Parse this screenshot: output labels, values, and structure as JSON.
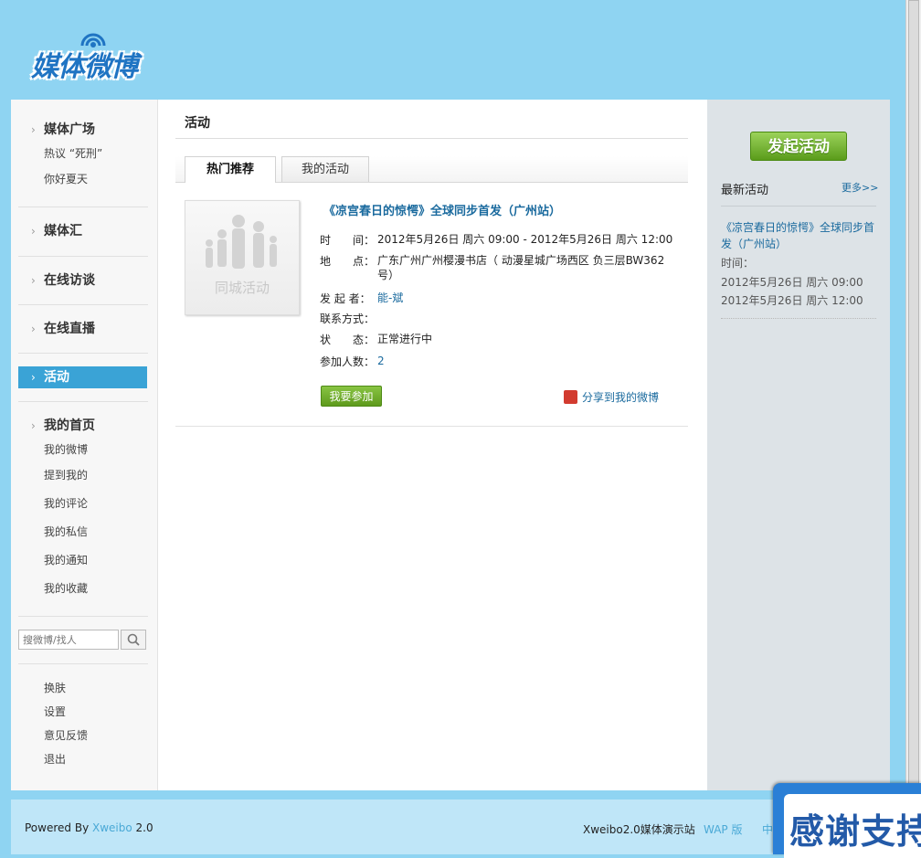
{
  "header": {
    "logo_text": "媒体微博"
  },
  "sidebar": {
    "groups": [
      {
        "label": "媒体广场",
        "items": [
          "热议 “死刑”",
          "你好夏天"
        ]
      },
      {
        "label": "媒体汇"
      },
      {
        "label": "在线访谈"
      },
      {
        "label": "在线直播"
      },
      {
        "label": "活动",
        "active": true
      },
      {
        "label": "我的首页",
        "items": [
          "我的微博",
          "提到我的",
          "我的评论",
          "我的私信",
          "我的通知",
          "我的收藏"
        ]
      }
    ],
    "search_placeholder": "搜微博/找人",
    "bottom_links": [
      "换肤",
      "设置",
      "意见反馈",
      "退出"
    ]
  },
  "main": {
    "title": "活动",
    "tabs": [
      {
        "label": "热门推荐",
        "active": true
      },
      {
        "label": "我的活动",
        "active": false
      }
    ],
    "event": {
      "poster_label": "同城活动",
      "title": "《凉宫春日的惊愕》全球同步首发（广州站）",
      "time_label": "时　　间：",
      "time_value": "2012年5月26日 周六  09:00 - 2012年5月26日 周六  12:00",
      "place_label": "地　　点：",
      "place_value": "广东广州广州樱漫书店（ 动漫星城广场西区 负三层BW362号）",
      "organizer_label": "发 起 者：",
      "organizer_value": "能-斌",
      "contact_label": "联系方式：",
      "contact_value": "",
      "status_label": "状　　态：",
      "status_value": "正常进行中",
      "count_label": "参加人数：",
      "count_value": "2",
      "join_button": "我要参加",
      "share_link": "分享到我的微博"
    }
  },
  "right": {
    "start_button": "发起活动",
    "latest_title": "最新活动",
    "more_link": "更多>>",
    "latest_event_title": "《凉宫春日的惊愕》全球同步首发（广州站）",
    "time_label": "时间：",
    "start_time": "2012年5月26日 周六 09:00",
    "end_time": "2012年5月26日 周六 12:00"
  },
  "footer": {
    "powered_by": "Powered By",
    "brand": "Xweibo",
    "version": "2.0",
    "site_name": "Xweibo2.0媒体演示站",
    "wap": "WAP 版",
    "lang": "中"
  },
  "banner": {
    "text": "感谢支持"
  },
  "colors": {
    "background": "#8fd4f2",
    "accent": "#3aa3d6",
    "link": "#1a6a9e",
    "green_button": "#5e9a1c"
  }
}
